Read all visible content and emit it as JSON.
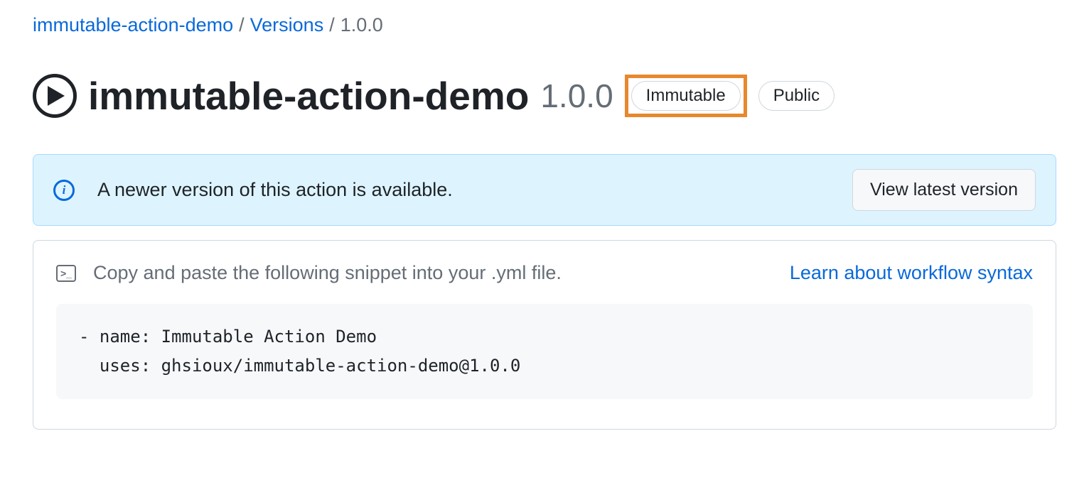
{
  "breadcrumb": {
    "repo": "immutable-action-demo",
    "versions": "Versions",
    "current": "1.0.0",
    "separator": "/"
  },
  "header": {
    "title": "immutable-action-demo",
    "version": "1.0.0",
    "badge_immutable": "Immutable",
    "badge_public": "Public"
  },
  "banner": {
    "message": "A newer version of this action is available.",
    "button_label": "View latest version"
  },
  "snippet": {
    "instruction": "Copy and paste the following snippet into your .yml file.",
    "learn_link": "Learn about workflow syntax",
    "code": "- name: Immutable Action Demo\n  uses: ghsioux/immutable-action-demo@1.0.0"
  }
}
